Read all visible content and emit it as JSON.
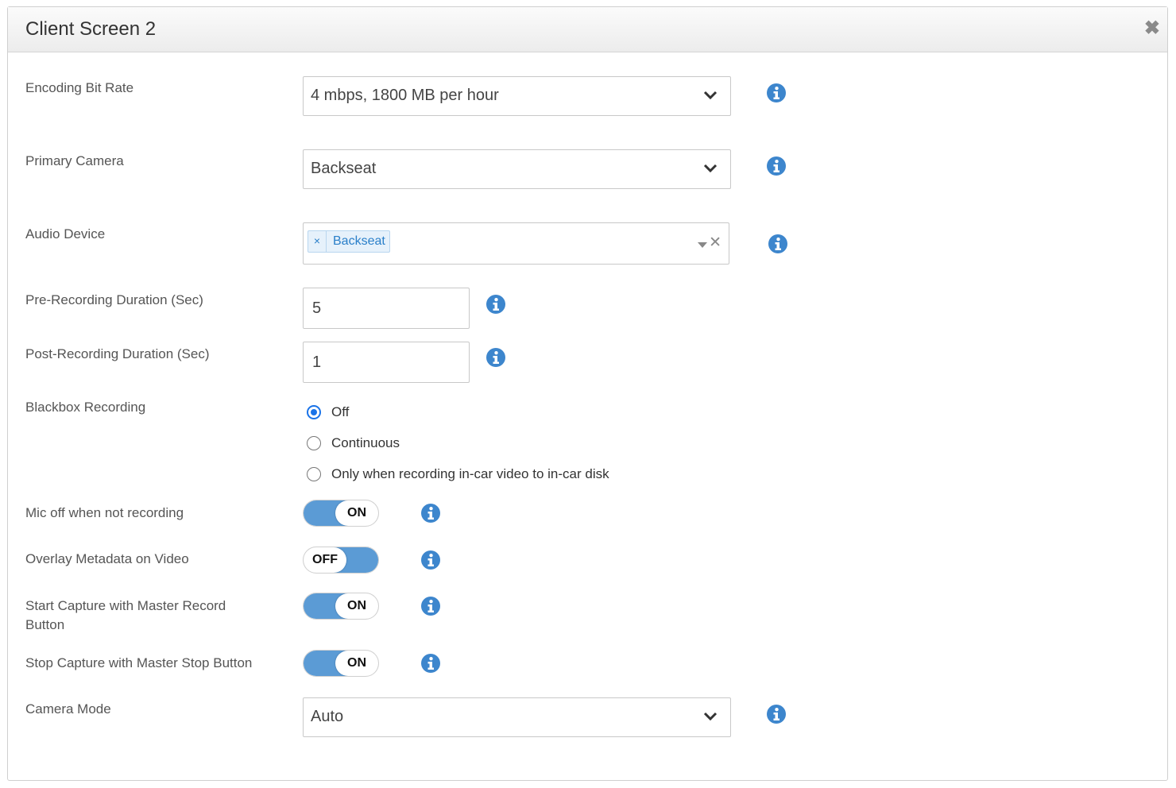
{
  "dialog": {
    "title": "Client Screen 2",
    "close_label": "✖"
  },
  "colors": {
    "accent": "#1a73e8",
    "info_icon": "#3d86cd",
    "toggle_track": "#5b9bd5"
  },
  "fields": {
    "encoding_bit_rate": {
      "label": "Encoding Bit Rate",
      "value": "4 mbps, 1800 MB per hour"
    },
    "primary_camera": {
      "label": "Primary Camera",
      "value": "Backseat"
    },
    "audio_device": {
      "label": "Audio Device",
      "tags": [
        "Backseat"
      ],
      "tag_remove": "×",
      "clear": "✕"
    },
    "pre_recording": {
      "label": "Pre-Recording Duration (Sec)",
      "value": "5"
    },
    "post_recording": {
      "label": "Post-Recording Duration (Sec)",
      "value": "1"
    },
    "blackbox": {
      "label": "Blackbox Recording",
      "options": [
        "Off",
        "Continuous",
        "Only when recording in-car video to in-car disk"
      ],
      "selected": "Off"
    },
    "mic_off": {
      "label": "Mic off when not recording",
      "state": "ON"
    },
    "overlay_metadata": {
      "label": "Overlay Metadata on Video",
      "state": "OFF"
    },
    "start_capture": {
      "label": "Start Capture with Master Record Button",
      "state": "ON"
    },
    "stop_capture": {
      "label": "Stop Capture with Master Stop Button",
      "state": "ON"
    },
    "camera_mode": {
      "label": "Camera Mode",
      "value": "Auto"
    }
  },
  "icons": {
    "info": "info-icon",
    "dropdown": "chevron-down-icon",
    "close": "close-icon"
  }
}
